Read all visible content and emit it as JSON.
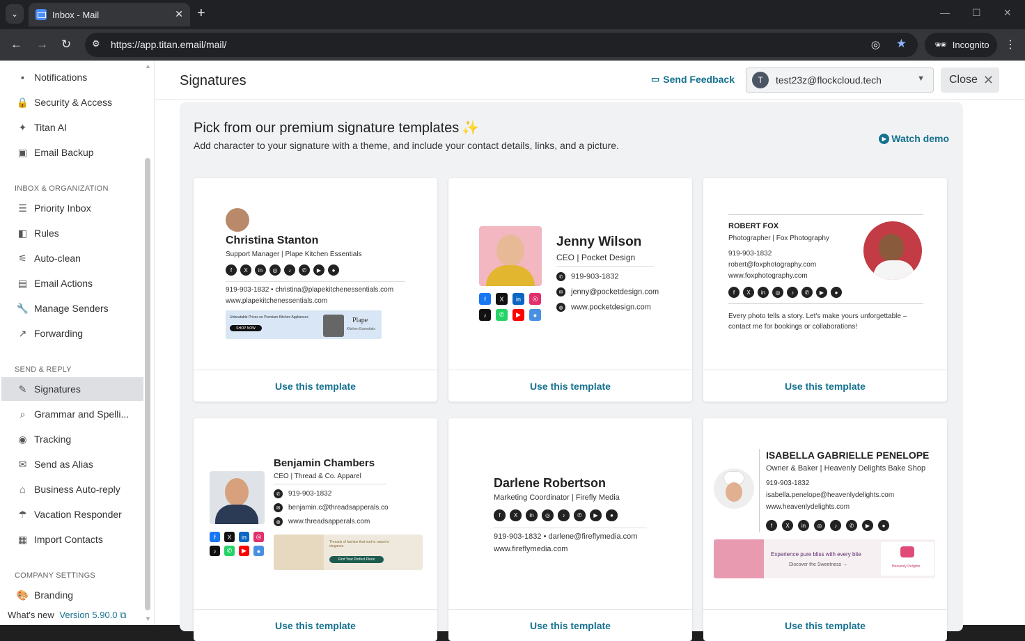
{
  "browser": {
    "tab_title": "Inbox - Mail",
    "url": "https://app.titan.email/mail/",
    "profile_label": "Incognito"
  },
  "sidebar": {
    "items_top": [
      {
        "label": "Notifications",
        "icon": "bell-icon"
      },
      {
        "label": "Security & Access",
        "icon": "lock-icon"
      },
      {
        "label": "Titan AI",
        "icon": "sparkle-icon"
      },
      {
        "label": "Email Backup",
        "icon": "backup-icon"
      }
    ],
    "section_inbox": "INBOX & ORGANIZATION",
    "items_inbox": [
      {
        "label": "Priority Inbox",
        "icon": "priority-icon"
      },
      {
        "label": "Rules",
        "icon": "rules-icon"
      },
      {
        "label": "Auto-clean",
        "icon": "broom-icon"
      },
      {
        "label": "Email Actions",
        "icon": "actions-icon"
      },
      {
        "label": "Manage Senders",
        "icon": "wrench-icon"
      },
      {
        "label": "Forwarding",
        "icon": "forward-icon"
      }
    ],
    "section_send": "SEND & REPLY",
    "items_send": [
      {
        "label": "Signatures",
        "icon": "pen-icon"
      },
      {
        "label": "Grammar and Spelli...",
        "icon": "grammar-icon"
      },
      {
        "label": "Tracking",
        "icon": "eye-icon"
      },
      {
        "label": "Send as Alias",
        "icon": "alias-icon"
      },
      {
        "label": "Business Auto-reply",
        "icon": "autoreply-icon"
      },
      {
        "label": "Vacation Responder",
        "icon": "umbrella-icon"
      },
      {
        "label": "Import Contacts",
        "icon": "contacts-icon"
      }
    ],
    "section_company": "COMPANY SETTINGS",
    "items_company": [
      {
        "label": "Branding",
        "icon": "palette-icon"
      }
    ],
    "whats_new": "What's new",
    "version": "Version 5.90.0"
  },
  "header": {
    "title": "Signatures",
    "feedback": "Send Feedback",
    "account_initial": "T",
    "account_email": "test23z@flockcloud.tech",
    "close": "Close"
  },
  "templates_panel": {
    "title": "Pick from our premium signature templates",
    "subtitle": "Add character to your signature with a theme, and include your contact details, links, and a picture.",
    "watch_demo": "Watch demo",
    "use_label": "Use this template",
    "cards": [
      {
        "name": "Christina Stanton",
        "role": "Support Manager",
        "company": "Plape Kitchen Essentials",
        "phone": "919-903-1832",
        "email": "christina@plapekitchenessentials.com",
        "website": "www.plapekitchenessentials.com",
        "banner_text": "Unbeatable Prices on Premium Kitchen Appliances",
        "banner_button": "SHOP NOW",
        "banner_brand": "Plape",
        "banner_brand_sub": "Kitchen Essentials"
      },
      {
        "name": "Jenny Wilson",
        "role": "CEO",
        "company": "Pocket Design",
        "phone": "919-903-1832",
        "email": "jenny@pocketdesign.com",
        "website": "www.pocketdesign.com"
      },
      {
        "name": "ROBERT FOX",
        "role": "Photographer",
        "company": "Fox Photography",
        "phone": "919-903-1832",
        "email": "robert@foxphotography.com",
        "website": "www.foxphotography.com",
        "note": "Every photo tells a story. Let's make yours unforgettable – contact me for bookings or collaborations!"
      },
      {
        "name": "Benjamin Chambers",
        "role": "CEO",
        "company": "Thread & Co. Apparel",
        "phone": "919-903-1832",
        "email": "benjamin.c@threadsapperals.co",
        "website": "www.threadsapperals.com",
        "banner_text": "Threads of fashion that nod to nature's elegance.",
        "banner_button": "Find Your Perfect Piece"
      },
      {
        "name": "Darlene Robertson",
        "role": "Marketing Coordinator",
        "company": "Firefly Media",
        "phone": "919-903-1832",
        "email": "darlene@fireflymedia.com",
        "website": "www.fireflymedia.com"
      },
      {
        "name": "ISABELLA GABRIELLE PENELOPE",
        "role": "Owner & Baker",
        "company": "Heavenly Delights Bake Shop",
        "phone": "919-903-1832",
        "email": "isabella.penelope@heavenlydelights.com",
        "website": "www.heavenlydelights.com",
        "banner_text": "Experience pure bliss with every bite",
        "banner_sub": "Discover the Sweetness →",
        "banner_brand": "Heavenly Delights"
      }
    ]
  },
  "colors": {
    "accent": "#15718f",
    "active_bg": "#dedfe3",
    "panel_bg": "#f1f2f4"
  }
}
